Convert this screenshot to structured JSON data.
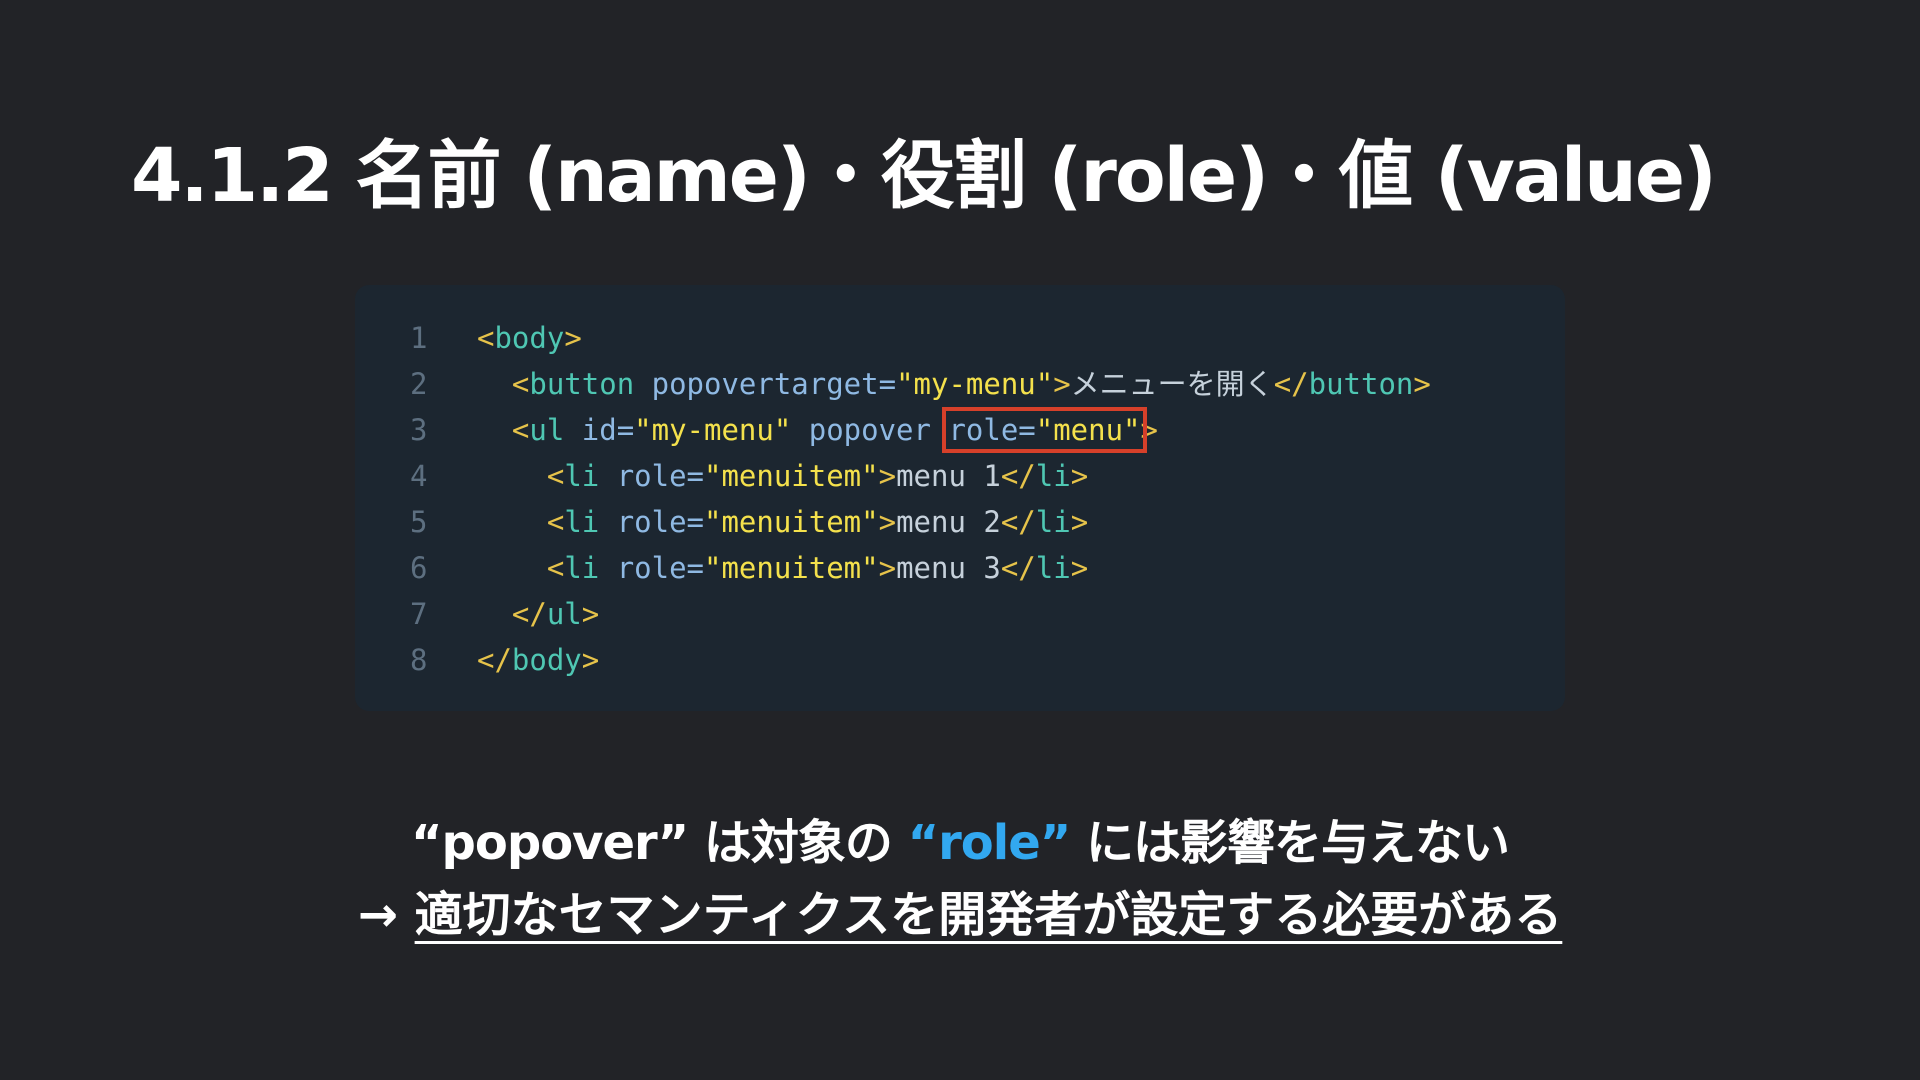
{
  "slide": {
    "title": "4.1.2 名前 (name)・役割 (role)・値 (value)",
    "colors": {
      "background": "#222327",
      "code_background": "#1c2630",
      "highlight_box": "#d6402a",
      "accent": "#32a8f0"
    }
  },
  "code": {
    "lines": [
      {
        "num": "1",
        "tokens": [
          {
            "t": "<",
            "c": "tag"
          },
          {
            "t": "body",
            "c": "tagname"
          },
          {
            "t": ">",
            "c": "tag"
          }
        ]
      },
      {
        "num": "2",
        "tokens": [
          {
            "t": "  ",
            "c": "txt"
          },
          {
            "t": "<",
            "c": "tag"
          },
          {
            "t": "button",
            "c": "tagname"
          },
          {
            "t": " popovertarget=",
            "c": "attr"
          },
          {
            "t": "\"my-menu\"",
            "c": "str"
          },
          {
            "t": ">",
            "c": "tag"
          },
          {
            "t": "メニューを開く",
            "c": "txt"
          },
          {
            "t": "</",
            "c": "tag"
          },
          {
            "t": "button",
            "c": "tagname"
          },
          {
            "t": ">",
            "c": "tag"
          }
        ]
      },
      {
        "num": "3",
        "tokens": [
          {
            "t": "  ",
            "c": "txt"
          },
          {
            "t": "<",
            "c": "tag"
          },
          {
            "t": "ul",
            "c": "tagname"
          },
          {
            "t": " id=",
            "c": "attr"
          },
          {
            "t": "\"my-menu\"",
            "c": "str"
          },
          {
            "t": " popover ",
            "c": "attr"
          },
          {
            "t": "role=",
            "c": "attr",
            "hl": "start"
          },
          {
            "t": "\"menu\"",
            "c": "str",
            "hl": "end"
          },
          {
            "t": ">",
            "c": "tag"
          }
        ]
      },
      {
        "num": "4",
        "tokens": [
          {
            "t": "    ",
            "c": "txt"
          },
          {
            "t": "<",
            "c": "tag"
          },
          {
            "t": "li",
            "c": "tagname"
          },
          {
            "t": " role=",
            "c": "attr"
          },
          {
            "t": "\"menuitem\"",
            "c": "str"
          },
          {
            "t": ">",
            "c": "tag"
          },
          {
            "t": "menu 1",
            "c": "txt"
          },
          {
            "t": "</",
            "c": "tag"
          },
          {
            "t": "li",
            "c": "tagname"
          },
          {
            "t": ">",
            "c": "tag"
          }
        ]
      },
      {
        "num": "5",
        "tokens": [
          {
            "t": "    ",
            "c": "txt"
          },
          {
            "t": "<",
            "c": "tag"
          },
          {
            "t": "li",
            "c": "tagname"
          },
          {
            "t": " role=",
            "c": "attr"
          },
          {
            "t": "\"menuitem\"",
            "c": "str"
          },
          {
            "t": ">",
            "c": "tag"
          },
          {
            "t": "menu 2",
            "c": "txt"
          },
          {
            "t": "</",
            "c": "tag"
          },
          {
            "t": "li",
            "c": "tagname"
          },
          {
            "t": ">",
            "c": "tag"
          }
        ]
      },
      {
        "num": "6",
        "tokens": [
          {
            "t": "    ",
            "c": "txt"
          },
          {
            "t": "<",
            "c": "tag"
          },
          {
            "t": "li",
            "c": "tagname"
          },
          {
            "t": " role=",
            "c": "attr"
          },
          {
            "t": "\"menuitem\"",
            "c": "str"
          },
          {
            "t": ">",
            "c": "tag"
          },
          {
            "t": "menu 3",
            "c": "txt"
          },
          {
            "t": "</",
            "c": "tag"
          },
          {
            "t": "li",
            "c": "tagname"
          },
          {
            "t": ">",
            "c": "tag"
          }
        ]
      },
      {
        "num": "7",
        "tokens": [
          {
            "t": "  ",
            "c": "txt"
          },
          {
            "t": "</",
            "c": "tag"
          },
          {
            "t": "ul",
            "c": "tagname"
          },
          {
            "t": ">",
            "c": "tag"
          }
        ]
      },
      {
        "num": "8",
        "tokens": [
          {
            "t": "</",
            "c": "tag"
          },
          {
            "t": "body",
            "c": "tagname"
          },
          {
            "t": ">",
            "c": "tag"
          }
        ]
      }
    ]
  },
  "caption": {
    "line1_prefix": "“popover” は対象の ",
    "line1_accent": "“role”",
    "line1_suffix": " には影響を与えない",
    "line2_arrow": "→ ",
    "line2_text": "適切なセマンティクスを開発者が設定する必要がある"
  }
}
